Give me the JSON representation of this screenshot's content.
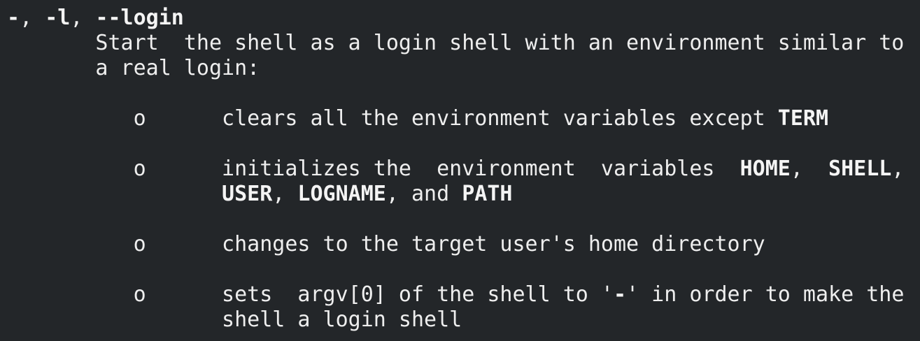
{
  "terminal": {
    "background": "#232629",
    "foreground": "#eeeeee",
    "option_header": {
      "dash": "-",
      "sep1": ", ",
      "short_opt": "-l",
      "sep2": ", ",
      "long_opt": "--login"
    },
    "description": {
      "line1": "       Start  the shell as a login shell with an environment similar to",
      "line2": "       a real login:"
    },
    "bullets": [
      {
        "marker": "          o      ",
        "text_a": "clears all the environment variables except ",
        "bold_a": "TERM"
      },
      {
        "marker": "          o      ",
        "text_a": "initializes the  environment  variables  ",
        "bold_a": "HOME",
        "text_b": ",  ",
        "bold_b": "SHELL",
        "text_c": ",",
        "cont_indent": "                 ",
        "cont_bold_a": "USER",
        "cont_text_a": ", ",
        "cont_bold_b": "LOGNAME",
        "cont_text_b": ", and ",
        "cont_bold_c": "PATH"
      },
      {
        "marker": "          o      ",
        "text_a": "changes to the target user's home directory"
      },
      {
        "marker": "          o      ",
        "text_a": "sets  argv[0] of the shell to '",
        "bold_a": "-",
        "text_b": "' in order to make the",
        "cont_indent": "                 ",
        "cont_text_a": "shell a login shell"
      }
    ]
  }
}
